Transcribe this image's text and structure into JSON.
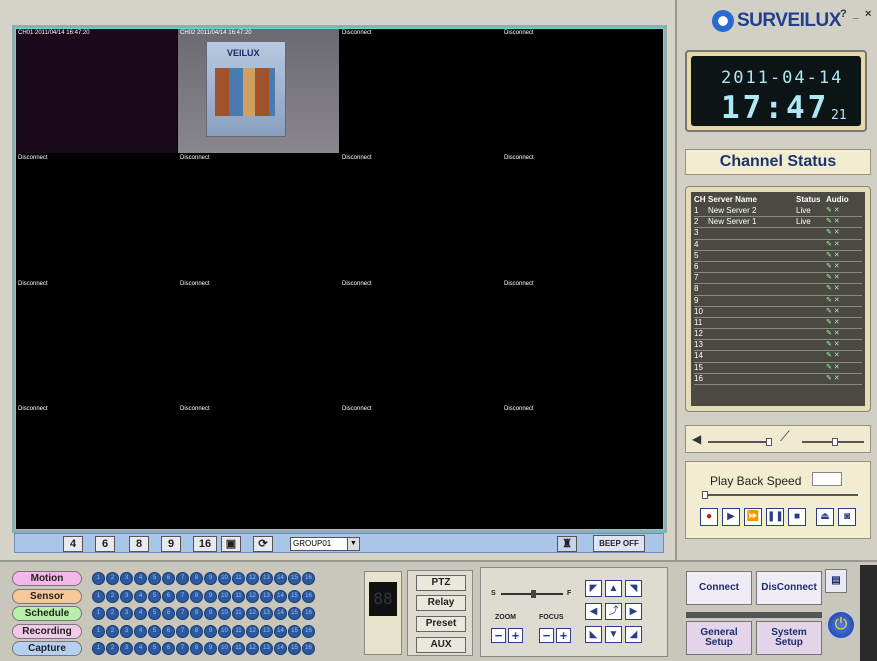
{
  "video": {
    "cells": [
      "CH01  2011/04/14 16:47:20",
      "CH02  2011/04/14 16:47:20",
      "Disconnect",
      "Disconnect",
      "Disconnect",
      "Disconnect",
      "Disconnect",
      "Disconnect",
      "Disconnect",
      "Disconnect",
      "Disconnect",
      "Disconnect",
      "Disconnect",
      "Disconnect",
      "Disconnect",
      "Disconnect"
    ],
    "cam_text": "VEILUX"
  },
  "toolbar": {
    "split4": "4",
    "split6": "6",
    "split8": "8",
    "split9": "9",
    "split16": "16",
    "group": "GROUP01",
    "beep": "BEEP OFF"
  },
  "header": {
    "brand": "SURVEILUX",
    "help": "?",
    "minimize": "_",
    "close": "×"
  },
  "clock": {
    "date": "2011-04-14",
    "time": "17:47",
    "seconds": "21"
  },
  "channel_status": {
    "title": "Channel Status",
    "headers": {
      "ch": "CH",
      "name": "Server Name",
      "status": "Status",
      "audio": "Audio"
    },
    "rows": [
      {
        "ch": "1",
        "name": "New Server 2",
        "status": "Live"
      },
      {
        "ch": "2",
        "name": "New Server 1",
        "status": "Live"
      },
      {
        "ch": "3",
        "name": "",
        "status": ""
      },
      {
        "ch": "4",
        "name": "",
        "status": ""
      },
      {
        "ch": "5",
        "name": "",
        "status": ""
      },
      {
        "ch": "6",
        "name": "",
        "status": ""
      },
      {
        "ch": "7",
        "name": "",
        "status": ""
      },
      {
        "ch": "8",
        "name": "",
        "status": ""
      },
      {
        "ch": "9",
        "name": "",
        "status": ""
      },
      {
        "ch": "10",
        "name": "",
        "status": ""
      },
      {
        "ch": "11",
        "name": "",
        "status": ""
      },
      {
        "ch": "12",
        "name": "",
        "status": ""
      },
      {
        "ch": "13",
        "name": "",
        "status": ""
      },
      {
        "ch": "14",
        "name": "",
        "status": ""
      },
      {
        "ch": "15",
        "name": "",
        "status": ""
      },
      {
        "ch": "16",
        "name": "",
        "status": ""
      }
    ]
  },
  "playback": {
    "label": "Play Back Speed"
  },
  "io": {
    "rows": [
      {
        "label": "Motion",
        "color": "#f4b8e8"
      },
      {
        "label": "Sensor",
        "color": "#f6c898"
      },
      {
        "label": "Schedule",
        "color": "#b8f0a8"
      },
      {
        "label": "Recording",
        "color": "#f4c8e8"
      },
      {
        "label": "Capture",
        "color": "#b8cff4"
      }
    ],
    "numbers": [
      "1",
      "2",
      "3",
      "4",
      "5",
      "6",
      "7",
      "8",
      "9",
      "10",
      "11",
      "12",
      "13",
      "14",
      "15",
      "16"
    ]
  },
  "seg_display": "88",
  "ptz": {
    "ptz": "PTZ",
    "relay": "Relay",
    "preset": "Preset",
    "aux": "AUX",
    "s": "S",
    "f": "F",
    "zoom": "ZOOM",
    "focus": "FOCUS"
  },
  "actions": {
    "connect": "Connect",
    "disconnect": "DisConnect",
    "general": "General Setup",
    "system": "System Setup"
  }
}
